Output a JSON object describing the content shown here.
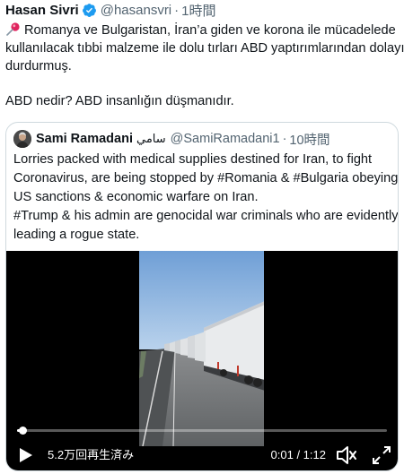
{
  "tweet": {
    "display_name": "Hasan Sivri",
    "handle": "@hasansvri",
    "separator": "·",
    "time": "1時間",
    "verified_icon": "verified-badge-icon",
    "pin_icon": "pushpin-icon",
    "text_lines": [
      "Romanya ve Bulgaristan, İran’a giden ve korona ile mücadelede",
      "kullanılacak tıbbi malzeme ile dolu tırları ABD yaptırımlarından dolayı",
      "durdurmuş."
    ],
    "text_line_2": "ABD nedir? ABD insanlığın düşmanıdır."
  },
  "quoted_tweet": {
    "display_name": "Sami Ramadani",
    "arabic_name": "سامي",
    "handle": "@SamiRamadani1",
    "separator": "·",
    "time": "10時間",
    "text_lines": [
      "Lorries packed with medical supplies destined for Iran, to fight",
      "Coronavirus, are being stopped by #Romania & #Bulgaria obeying",
      "US sanctions & economic warfare on Iran.",
      "#Trump & his admin are genocidal war criminals who are evidently",
      "leading a rogue state."
    ]
  },
  "video": {
    "views": "5.2万回再生済み",
    "time_readout": "0:01 / 1:12",
    "progress": 0.014,
    "controls": [
      "play-icon",
      "volume-icon",
      "fullscreen-icon"
    ]
  },
  "colors": {
    "text": "#0f1419",
    "secondary": "#536471",
    "verified": "#1d9bf0",
    "border": "#cfd9de",
    "video_bg": "#000000"
  }
}
